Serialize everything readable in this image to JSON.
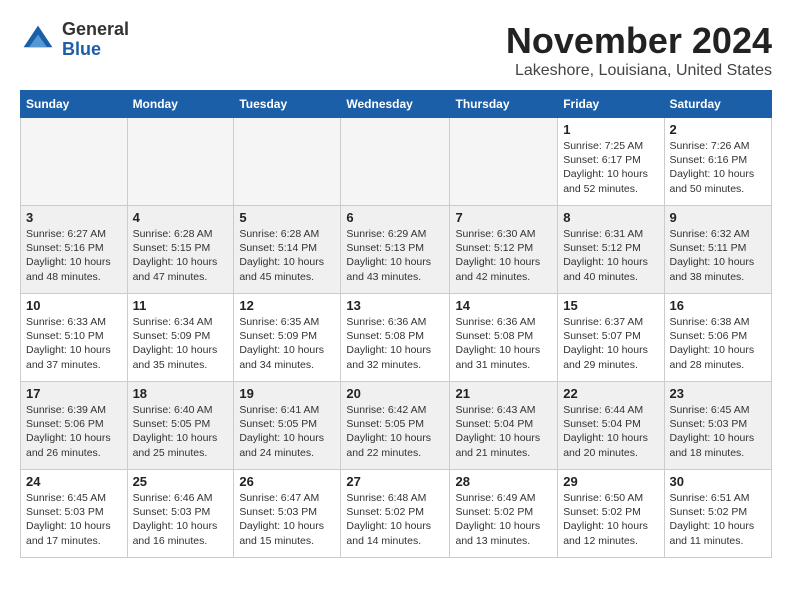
{
  "logo": {
    "general": "General",
    "blue": "Blue"
  },
  "title": "November 2024",
  "location": "Lakeshore, Louisiana, United States",
  "weekdays": [
    "Sunday",
    "Monday",
    "Tuesday",
    "Wednesday",
    "Thursday",
    "Friday",
    "Saturday"
  ],
  "weeks": [
    [
      {
        "day": "",
        "info": ""
      },
      {
        "day": "",
        "info": ""
      },
      {
        "day": "",
        "info": ""
      },
      {
        "day": "",
        "info": ""
      },
      {
        "day": "",
        "info": ""
      },
      {
        "day": "1",
        "info": "Sunrise: 7:25 AM\nSunset: 6:17 PM\nDaylight: 10 hours\nand 52 minutes."
      },
      {
        "day": "2",
        "info": "Sunrise: 7:26 AM\nSunset: 6:16 PM\nDaylight: 10 hours\nand 50 minutes."
      }
    ],
    [
      {
        "day": "3",
        "info": "Sunrise: 6:27 AM\nSunset: 5:16 PM\nDaylight: 10 hours\nand 48 minutes."
      },
      {
        "day": "4",
        "info": "Sunrise: 6:28 AM\nSunset: 5:15 PM\nDaylight: 10 hours\nand 47 minutes."
      },
      {
        "day": "5",
        "info": "Sunrise: 6:28 AM\nSunset: 5:14 PM\nDaylight: 10 hours\nand 45 minutes."
      },
      {
        "day": "6",
        "info": "Sunrise: 6:29 AM\nSunset: 5:13 PM\nDaylight: 10 hours\nand 43 minutes."
      },
      {
        "day": "7",
        "info": "Sunrise: 6:30 AM\nSunset: 5:12 PM\nDaylight: 10 hours\nand 42 minutes."
      },
      {
        "day": "8",
        "info": "Sunrise: 6:31 AM\nSunset: 5:12 PM\nDaylight: 10 hours\nand 40 minutes."
      },
      {
        "day": "9",
        "info": "Sunrise: 6:32 AM\nSunset: 5:11 PM\nDaylight: 10 hours\nand 38 minutes."
      }
    ],
    [
      {
        "day": "10",
        "info": "Sunrise: 6:33 AM\nSunset: 5:10 PM\nDaylight: 10 hours\nand 37 minutes."
      },
      {
        "day": "11",
        "info": "Sunrise: 6:34 AM\nSunset: 5:09 PM\nDaylight: 10 hours\nand 35 minutes."
      },
      {
        "day": "12",
        "info": "Sunrise: 6:35 AM\nSunset: 5:09 PM\nDaylight: 10 hours\nand 34 minutes."
      },
      {
        "day": "13",
        "info": "Sunrise: 6:36 AM\nSunset: 5:08 PM\nDaylight: 10 hours\nand 32 minutes."
      },
      {
        "day": "14",
        "info": "Sunrise: 6:36 AM\nSunset: 5:08 PM\nDaylight: 10 hours\nand 31 minutes."
      },
      {
        "day": "15",
        "info": "Sunrise: 6:37 AM\nSunset: 5:07 PM\nDaylight: 10 hours\nand 29 minutes."
      },
      {
        "day": "16",
        "info": "Sunrise: 6:38 AM\nSunset: 5:06 PM\nDaylight: 10 hours\nand 28 minutes."
      }
    ],
    [
      {
        "day": "17",
        "info": "Sunrise: 6:39 AM\nSunset: 5:06 PM\nDaylight: 10 hours\nand 26 minutes."
      },
      {
        "day": "18",
        "info": "Sunrise: 6:40 AM\nSunset: 5:05 PM\nDaylight: 10 hours\nand 25 minutes."
      },
      {
        "day": "19",
        "info": "Sunrise: 6:41 AM\nSunset: 5:05 PM\nDaylight: 10 hours\nand 24 minutes."
      },
      {
        "day": "20",
        "info": "Sunrise: 6:42 AM\nSunset: 5:05 PM\nDaylight: 10 hours\nand 22 minutes."
      },
      {
        "day": "21",
        "info": "Sunrise: 6:43 AM\nSunset: 5:04 PM\nDaylight: 10 hours\nand 21 minutes."
      },
      {
        "day": "22",
        "info": "Sunrise: 6:44 AM\nSunset: 5:04 PM\nDaylight: 10 hours\nand 20 minutes."
      },
      {
        "day": "23",
        "info": "Sunrise: 6:45 AM\nSunset: 5:03 PM\nDaylight: 10 hours\nand 18 minutes."
      }
    ],
    [
      {
        "day": "24",
        "info": "Sunrise: 6:45 AM\nSunset: 5:03 PM\nDaylight: 10 hours\nand 17 minutes."
      },
      {
        "day": "25",
        "info": "Sunrise: 6:46 AM\nSunset: 5:03 PM\nDaylight: 10 hours\nand 16 minutes."
      },
      {
        "day": "26",
        "info": "Sunrise: 6:47 AM\nSunset: 5:03 PM\nDaylight: 10 hours\nand 15 minutes."
      },
      {
        "day": "27",
        "info": "Sunrise: 6:48 AM\nSunset: 5:02 PM\nDaylight: 10 hours\nand 14 minutes."
      },
      {
        "day": "28",
        "info": "Sunrise: 6:49 AM\nSunset: 5:02 PM\nDaylight: 10 hours\nand 13 minutes."
      },
      {
        "day": "29",
        "info": "Sunrise: 6:50 AM\nSunset: 5:02 PM\nDaylight: 10 hours\nand 12 minutes."
      },
      {
        "day": "30",
        "info": "Sunrise: 6:51 AM\nSunset: 5:02 PM\nDaylight: 10 hours\nand 11 minutes."
      }
    ]
  ]
}
